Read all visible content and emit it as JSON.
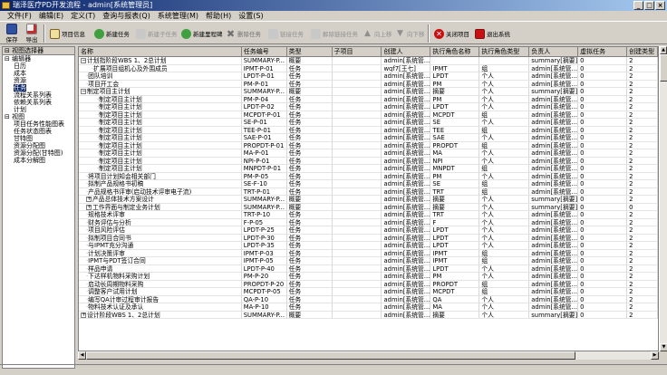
{
  "window": {
    "title": "瑞泽医疗PD开发流程 - admin[系统管理员]"
  },
  "menu": [
    "文件(F)",
    "编辑(E)",
    "定义(T)",
    "查询与报表(Q)",
    "系统管理(M)",
    "帮助(H)",
    "设置(S)"
  ],
  "toolbar": {
    "save": "保存",
    "export": "导出",
    "project_info": "项目信息",
    "new_task": "新建任务",
    "new_subtask": "新建子任务",
    "new_milestone": "新建里程碑",
    "delete_task": "删除任务",
    "link_tasks": "链接任务",
    "unlink_tasks": "解除链接任务",
    "move_up": "向上移",
    "move_down": "向下移",
    "close_project": "关闭项目",
    "exit_system": "退出系统"
  },
  "left_panel": {
    "header": "视图选择器",
    "items": [
      {
        "label": "编辑器",
        "level": 0,
        "prefix": "⊟"
      },
      {
        "label": "日历",
        "level": 1
      },
      {
        "label": "成本",
        "level": 1
      },
      {
        "label": "资源",
        "level": 1
      },
      {
        "label": "任务",
        "level": 1,
        "selected": true
      },
      {
        "label": "流程关系列表",
        "level": 1
      },
      {
        "label": "依赖关系列表",
        "level": 1
      },
      {
        "label": "计划",
        "level": 1
      },
      {
        "label": "视图",
        "level": 0,
        "prefix": "⊟"
      },
      {
        "label": "项目任务性能图表",
        "level": 1
      },
      {
        "label": "任务状态图表",
        "level": 1
      },
      {
        "label": "甘特图",
        "level": 1
      },
      {
        "label": "资源分配图",
        "level": 1
      },
      {
        "label": "资源分配(甘特图)",
        "level": 1
      },
      {
        "label": "成本分解图",
        "level": 1
      }
    ]
  },
  "grid": {
    "columns": [
      "名称",
      "任务编号",
      "类型",
      "子项目",
      "创建人",
      "执行角色名称",
      "执行角色类型",
      "负责人",
      "虚拟任务",
      "创建类型"
    ],
    "rows": [
      {
        "indent": 0,
        "expander": "⊟",
        "cells": [
          "计划指阶段WBS 1、2总计划",
          "SUMMARY-P...",
          "概要",
          "",
          "admin[系统管...",
          "",
          "",
          "summary[摘要]",
          "0",
          "2"
        ]
      },
      {
        "indent": 2,
        "cells": [
          "扩展项目组机心及外围成员",
          "IPMT-P-01",
          "任务",
          "",
          "wqf7[王七]",
          "IPMT",
          "组",
          "admin[系统管...",
          "0",
          "2"
        ]
      },
      {
        "indent": 1,
        "cells": [
          "团队培训",
          "LPDT-P-01",
          "任务",
          "",
          "admin[系统管...",
          "LPDT",
          "个人",
          "admin[系统管...",
          "0",
          "2"
        ]
      },
      {
        "indent": 1,
        "cells": [
          "项目开工会",
          "PM-P-01",
          "任务",
          "",
          "admin[系统管...",
          "PM",
          "个人",
          "admin[系统管...",
          "0",
          "2"
        ]
      },
      {
        "indent": 0,
        "expander": "⊟",
        "cells": [
          "制定项目主计划",
          "SUMMARY-P...",
          "概要",
          "",
          "admin[系统管...",
          "摘要",
          "个人",
          "summary[摘要]",
          "0",
          "2"
        ]
      },
      {
        "indent": 3,
        "cells": [
          "制定项目主计划",
          "PM-P-04",
          "任务",
          "",
          "admin[系统管...",
          "PM",
          "个人",
          "admin[系统管...",
          "0",
          "2"
        ]
      },
      {
        "indent": 3,
        "cells": [
          "制定项目主计划",
          "LPDT-P-02",
          "任务",
          "",
          "admin[系统管...",
          "LPDT",
          "个人",
          "admin[系统管...",
          "0",
          "2"
        ]
      },
      {
        "indent": 3,
        "cells": [
          "制定项目主计划",
          "MCPDT-P-01",
          "任务",
          "",
          "admin[系统管...",
          "MCPDT",
          "组",
          "admin[系统管...",
          "0",
          "2"
        ]
      },
      {
        "indent": 3,
        "cells": [
          "制定项目主计划",
          "SE-P-01",
          "任务",
          "",
          "admin[系统管...",
          "SE",
          "个人",
          "admin[系统管...",
          "0",
          "2"
        ]
      },
      {
        "indent": 3,
        "cells": [
          "制定项目主计划",
          "TEE-P-01",
          "任务",
          "",
          "admin[系统管...",
          "TEE",
          "组",
          "admin[系统管...",
          "0",
          "2"
        ]
      },
      {
        "indent": 3,
        "cells": [
          "制定项目主计划",
          "SAE-P-01",
          "任务",
          "",
          "admin[系统管...",
          "SAE",
          "个人",
          "admin[系统管...",
          "0",
          "2"
        ]
      },
      {
        "indent": 3,
        "cells": [
          "制定项目主计划",
          "PROPDT-P-01",
          "任务",
          "",
          "admin[系统管...",
          "PROPDT",
          "组",
          "admin[系统管...",
          "0",
          "2"
        ]
      },
      {
        "indent": 3,
        "cells": [
          "制定项目主计划",
          "MA-P-01",
          "任务",
          "",
          "admin[系统管...",
          "MA",
          "个人",
          "admin[系统管...",
          "0",
          "2"
        ]
      },
      {
        "indent": 3,
        "cells": [
          "制定项目主计划",
          "NPI-P-01",
          "任务",
          "",
          "admin[系统管...",
          "NPI",
          "个人",
          "admin[系统管...",
          "0",
          "2"
        ]
      },
      {
        "indent": 3,
        "cells": [
          "制定项目主计划",
          "MNPDT-P-01",
          "任务",
          "",
          "admin[系统管...",
          "MNPDT",
          "组",
          "admin[系统管...",
          "0",
          "2"
        ]
      },
      {
        "indent": 1,
        "cells": [
          "将项目计划知会相关部门",
          "PM-P-05",
          "任务",
          "",
          "admin[系统管...",
          "PM",
          "个人",
          "admin[系统管...",
          "0",
          "2"
        ]
      },
      {
        "indent": 1,
        "cells": [
          "拟制产品规格书初稿",
          "SE-F-10",
          "任务",
          "",
          "admin[系统管...",
          "SE",
          "组",
          "admin[系统管...",
          "0",
          "2"
        ]
      },
      {
        "indent": 1,
        "cells": [
          "产品规格书评审(启动技术评审电子流)",
          "TRT-P-01",
          "任务",
          "",
          "admin[系统管...",
          "TRT",
          "组",
          "admin[系统管...",
          "0",
          "2"
        ]
      },
      {
        "indent": 1,
        "expander": "⊞",
        "cells": [
          "产品总体技术方案设计",
          "SUMMARY-P...",
          "概要",
          "",
          "admin[系统管...",
          "摘要",
          "个人",
          "summary[摘要]",
          "0",
          "2"
        ]
      },
      {
        "indent": 1,
        "expander": "⊞",
        "cells": [
          "工作界面与制定业务计划",
          "SUMMARY-P...",
          "概要",
          "",
          "admin[系统管...",
          "摘要",
          "个人",
          "summary[摘要]",
          "0",
          "0"
        ]
      },
      {
        "indent": 1,
        "cells": [
          "规格技术评审",
          "TRT-P-10",
          "任务",
          "",
          "admin[系统管...",
          "TRT",
          "个人",
          "admin[系统管...",
          "0",
          "2"
        ]
      },
      {
        "indent": 1,
        "cells": [
          "财务评估与分析",
          "F-P-05",
          "任务",
          "",
          "admin[系统管...",
          "F",
          "个人",
          "admin[系统管...",
          "0",
          "2"
        ]
      },
      {
        "indent": 1,
        "cells": [
          "项目风险评估",
          "LPDT-P-25",
          "任务",
          "",
          "admin[系统管...",
          "LPDT",
          "个人",
          "admin[系统管...",
          "0",
          "2"
        ]
      },
      {
        "indent": 1,
        "cells": [
          "拟制项目合同书",
          "LPDT-P-30",
          "任务",
          "",
          "admin[系统管...",
          "LPDT",
          "个人",
          "admin[系统管...",
          "0",
          "2"
        ]
      },
      {
        "indent": 1,
        "cells": [
          "与IPMT充分沟通",
          "LPDT-P-35",
          "任务",
          "",
          "admin[系统管...",
          "LPDT",
          "个人",
          "admin[系统管...",
          "0",
          "2"
        ]
      },
      {
        "indent": 1,
        "cells": [
          "计划决策评审",
          "IPMT-P-03",
          "任务",
          "",
          "admin[系统管...",
          "IPMT",
          "组",
          "admin[系统管...",
          "0",
          "2"
        ]
      },
      {
        "indent": 1,
        "cells": [
          "IPMT与PDT签订合同",
          "IPMT-P-05",
          "任务",
          "",
          "admin[系统管...",
          "IPMT",
          "组",
          "admin[系统管...",
          "0",
          "2"
        ]
      },
      {
        "indent": 1,
        "cells": [
          "样品申请",
          "LPDT-P-40",
          "任务",
          "",
          "admin[系统管...",
          "LPDT",
          "个人",
          "admin[系统管...",
          "0",
          "2"
        ]
      },
      {
        "indent": 1,
        "cells": [
          "下达样机物料采购计划",
          "PM-P-20",
          "任务",
          "",
          "admin[系统管...",
          "PM",
          "个人",
          "admin[系统管...",
          "0",
          "2"
        ]
      },
      {
        "indent": 1,
        "cells": [
          "启动长周期物料采购",
          "PROPDT-P-20",
          "任务",
          "",
          "admin[系统管...",
          "PROPDT",
          "组",
          "admin[系统管...",
          "0",
          "2"
        ]
      },
      {
        "indent": 1,
        "cells": [
          "调整客户试用计划",
          "MCPDT-P-05",
          "任务",
          "",
          "admin[系统管...",
          "MCPDT",
          "组",
          "admin[系统管...",
          "0",
          "2"
        ]
      },
      {
        "indent": 1,
        "cells": [
          "编写QA计审过程审计报告",
          "QA-P-10",
          "任务",
          "",
          "admin[系统管...",
          "QA",
          "个人",
          "admin[系统管...",
          "0",
          "2"
        ]
      },
      {
        "indent": 1,
        "cells": [
          "物料技术认证及承认",
          "MA-P-10",
          "任务",
          "",
          "admin[系统管...",
          "MA",
          "个人",
          "admin[系统管...",
          "0",
          "2"
        ]
      },
      {
        "indent": 0,
        "expander": "⊞",
        "cells": [
          "设计阶段WBS 1、2总计划",
          "SUMMARY-P...",
          "概要",
          "",
          "admin[系统管...",
          "摘要",
          "个人",
          "summary[摘要]",
          "0",
          "2"
        ]
      }
    ]
  },
  "colors": {
    "titlebar": "#0a246a",
    "selection": "#0a246a",
    "close_icon": "#c81010"
  },
  "icons": [
    "save-icon",
    "export-icon",
    "project-info-icon",
    "new-task-icon",
    "new-subtask-icon",
    "new-milestone-icon",
    "delete-task-icon",
    "link-icon",
    "unlink-icon",
    "up-arrow-icon",
    "down-arrow-icon",
    "close-project-icon",
    "exit-icon"
  ]
}
